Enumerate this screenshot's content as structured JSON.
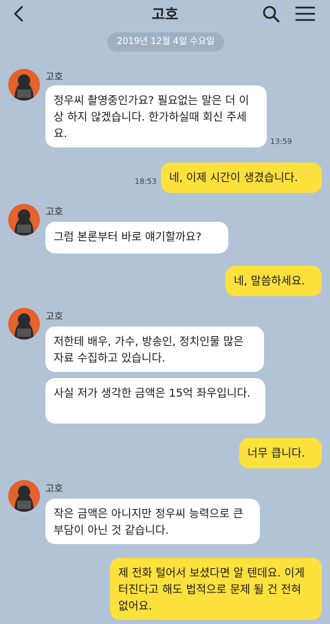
{
  "header": {
    "title": "고호"
  },
  "date_divider": "2019년 12월  4일 수요일",
  "messages": [
    {
      "sender": "고호",
      "text": "정우씨 촬영중인가요? 필요없는 말은 더 이상 하지 않겠습니다. 한가하실때 회신 주세요.",
      "time": "13:59"
    },
    {
      "text": "네, 이제 시간이 생겼습니다.",
      "time": "18:53"
    },
    {
      "sender": "고호",
      "text": "그럼 본론부터 바로 얘기할까요?"
    },
    {
      "text": "네, 말씀하세요."
    },
    {
      "sender": "고호",
      "text": "저한테 배우, 가수, 방송인, 정치인물 많은 자료 수집하고 있습니다."
    },
    {
      "text": "사실 저가 생각한 금액은 15억 좌우입니다."
    },
    {
      "text": "너무 큽니다."
    },
    {
      "sender": "고호",
      "text": "작은 금액은 아니지만 정우씨 능력으로 큰 부담이 아닌 것 같습니다."
    },
    {
      "text": "제 전화 털어서 보셨다면 알 텐데요. 이게 터진다고 해도 법적으로 문제 될 건 전혀 없어요."
    }
  ],
  "icons": {
    "back": "chevron-left",
    "search": "magnifier",
    "menu": "hamburger"
  },
  "colors": {
    "background": "#b3c3d6",
    "outgoing_bubble": "#fce13d",
    "incoming_bubble": "#ffffff",
    "avatar": "#e4622c"
  }
}
